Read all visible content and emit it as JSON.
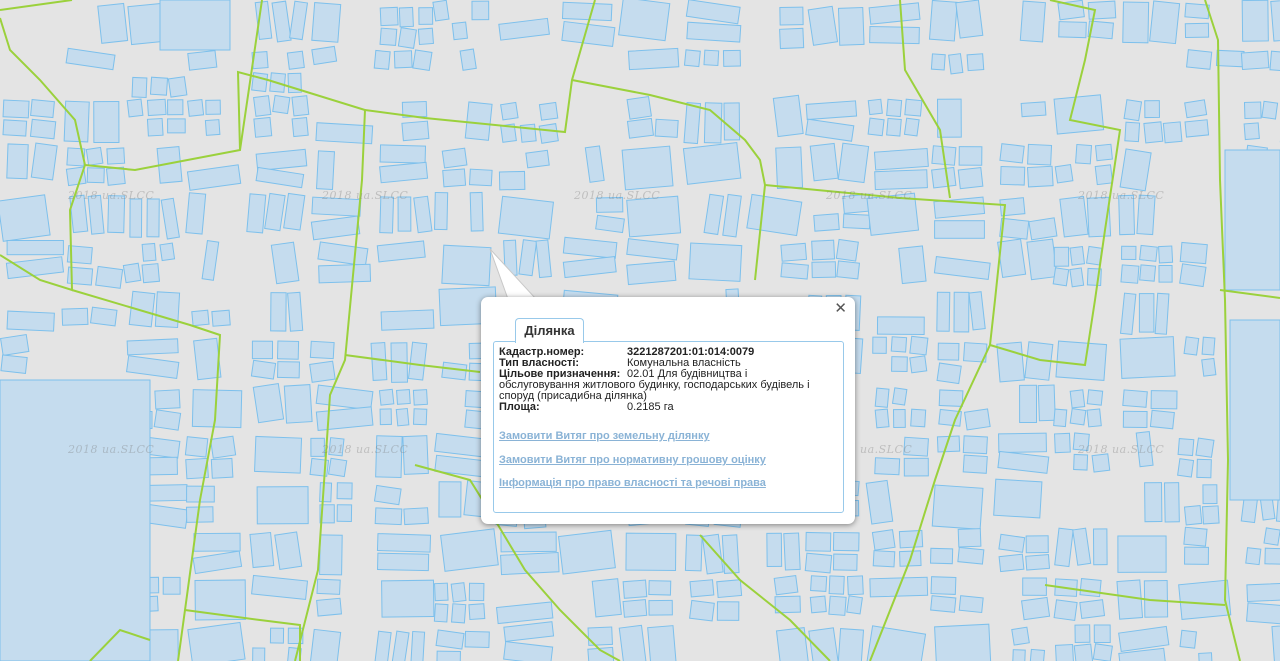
{
  "watermark": "2018 ua.SLCC",
  "colors": {
    "background": "#e4e4e4",
    "parcel_fill": "#c5dcee",
    "parcel_stroke": "#7dc0ec",
    "boundary": "#9bd13c",
    "link": "#8ab3d6"
  },
  "popup": {
    "tab_label": "Ділянка",
    "close_icon": "close-icon",
    "fields": {
      "cadastral_label": "Кадастр.номер:",
      "cadastral_value": "3221287201:01:014:0079",
      "ownership_label": "Тип власності:",
      "ownership_value": "Комунальна власність",
      "purpose_label": "Цільове призначення:",
      "purpose_value_1": "02.01 Для будівництва і",
      "purpose_value_2": "обслуговування житлового будинку, господарських будівель і",
      "purpose_value_3": "споруд (присадибна ділянка)",
      "area_label": "Площа:",
      "area_value": "0.2185 га"
    },
    "links": [
      "Замовити Витяг про земельну ділянку",
      "Замовити Витяг про нормативну грошову оцінку",
      "Інформація про право власності та речові права"
    ]
  }
}
